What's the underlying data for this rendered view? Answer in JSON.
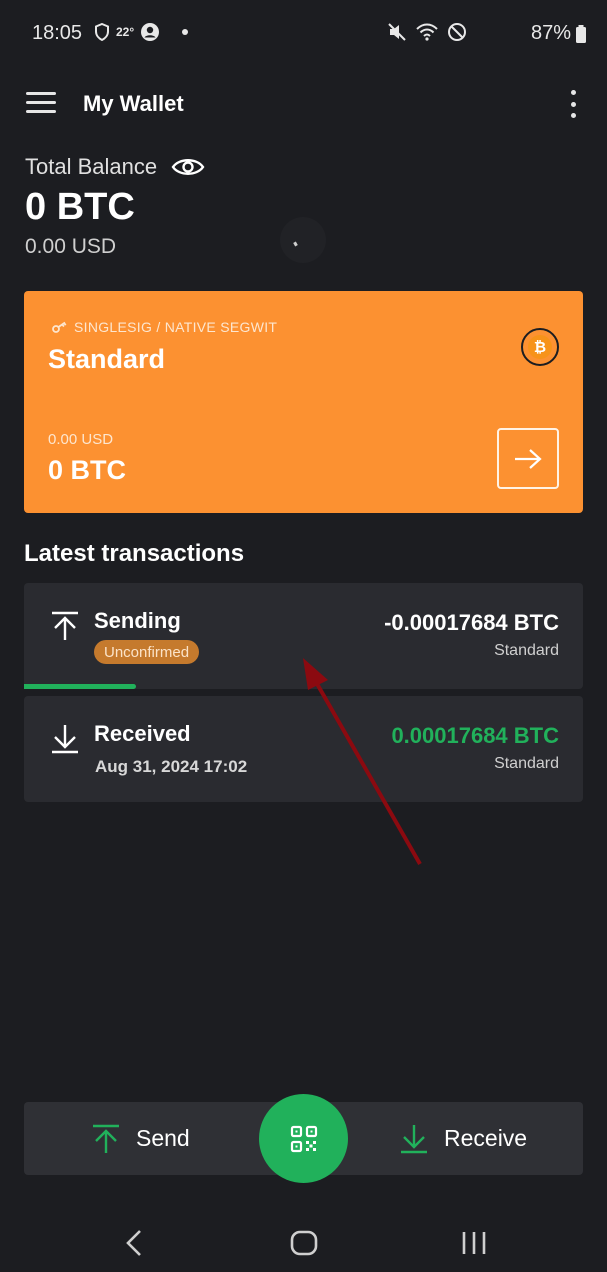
{
  "status_bar": {
    "time": "18:05",
    "temperature": "22°",
    "battery": "87%"
  },
  "app_bar": {
    "title": "My Wallet",
    "menu_icon": "hamburger-menu-icon",
    "more_icon": "more-vertical-icon"
  },
  "balance": {
    "label": "Total Balance",
    "btc": "0 BTC",
    "usd": "0.00 USD",
    "visibility_icon": "eye-icon"
  },
  "wallet_card": {
    "type": "SINGLESIG / NATIVE SEGWIT",
    "name": "Standard",
    "usd": "0.00 USD",
    "btc": "0 BTC",
    "color": "#fc9131"
  },
  "transactions": {
    "title": "Latest transactions",
    "items": [
      {
        "title": "Sending",
        "status": "Unconfirmed",
        "amount": "-0.00017684 BTC",
        "wallet": "Standard",
        "direction": "send",
        "progress": 0.2
      },
      {
        "title": "Received",
        "date": "Aug 31, 2024 17:02",
        "amount": "0.00017684 BTC",
        "wallet": "Standard",
        "direction": "receive",
        "amount_color": "#21b15b"
      }
    ]
  },
  "actions": {
    "send_label": "Send",
    "receive_label": "Receive",
    "accent": "#21b15b"
  }
}
